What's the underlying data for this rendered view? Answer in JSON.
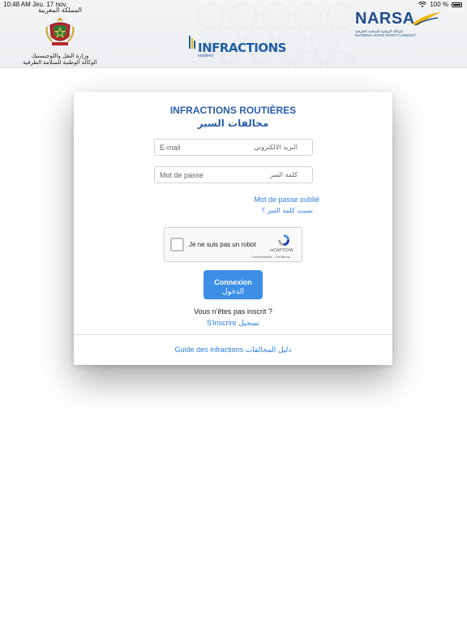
{
  "status_bar": {
    "time": "10:48 AM",
    "date": "Jeu. 17 nov.",
    "battery": "100 %"
  },
  "header": {
    "ministry": {
      "kingdom": "المملكة المغربية",
      "line1": "وزارة النقل واللوجيستيك",
      "line2": "الوكالة الوطنية للسلامة الطرقية"
    },
    "infractions_logo": {
      "text": "INFRACTIONS",
      "sub": "routières"
    },
    "narsa_logo": {
      "text": "NARSA",
      "sub_ar": "الوكالة الوطنية للسلامة الطرقية",
      "sub_en": "NATIONAL ROAD SAFETY AGENCY"
    }
  },
  "login": {
    "title": "INFRACTIONS ROUTIÈRES",
    "title_ar": "مخالفات السير",
    "email_placeholder": "E-mail",
    "email_placeholder_ar": "البريد الالكتروني",
    "password_placeholder": "Mot de passe",
    "password_placeholder_ar": "كلمة السر",
    "forgot_fr": "Mot de passe oublié",
    "forgot_ar": "نسيت كلمة السر ؟",
    "captcha": {
      "label": "Je ne suis pas un robot",
      "brand": "reCAPTCHA",
      "terms": "Confidentialité - Conditions"
    },
    "connexion_label": "Connexion",
    "connexion_label_ar": "الدخول",
    "not_registered": "Vous n'êtes pas inscrit ?",
    "register_fr": "S'inscrire",
    "register_ar": "تسجيل",
    "guide_fr": "Guide des infractions",
    "guide_ar": "دليل المخالفات"
  },
  "colors": {
    "accent": "#2a7de1",
    "title": "#2a5ea8",
    "button": "#3d8fe6"
  }
}
